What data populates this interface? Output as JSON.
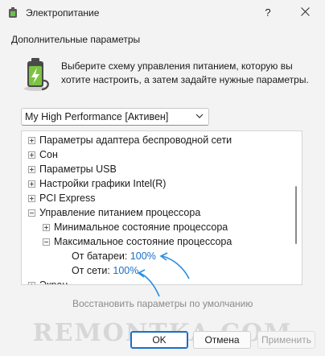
{
  "window": {
    "title": "Электропитание"
  },
  "header": {
    "section_title": "Дополнительные параметры",
    "description": "Выберите схему управления питанием, которую вы хотите настроить, а затем задайте нужные параметры."
  },
  "plan_select": {
    "selected": "My High Performance [Активен]"
  },
  "tree": {
    "items": [
      {
        "label": "Параметры адаптера беспроводной сети",
        "state": "collapsed"
      },
      {
        "label": "Сон",
        "state": "collapsed"
      },
      {
        "label": "Параметры USB",
        "state": "collapsed"
      },
      {
        "label": "Настройки графики Intel(R)",
        "state": "collapsed"
      },
      {
        "label": "PCI Express",
        "state": "collapsed"
      },
      {
        "label": "Управление питанием процессора",
        "state": "expanded"
      },
      {
        "label": "Минимальное состояние процессора",
        "state": "collapsed"
      },
      {
        "label": "Максимальное состояние процессора",
        "state": "expanded"
      },
      {
        "label": "От батареи:",
        "value": "100%"
      },
      {
        "label": "От сети:",
        "value": "100%"
      },
      {
        "label": "Экран",
        "state": "collapsed"
      }
    ]
  },
  "restore_link": "Восстановить параметры по умолчанию",
  "buttons": {
    "ok": "OK",
    "cancel": "Отмена",
    "apply": "Применить"
  },
  "watermark": "REMONTKA.COM",
  "colors": {
    "link": "#1a6fc9",
    "annotation_arrow": "#2b8fe0"
  }
}
